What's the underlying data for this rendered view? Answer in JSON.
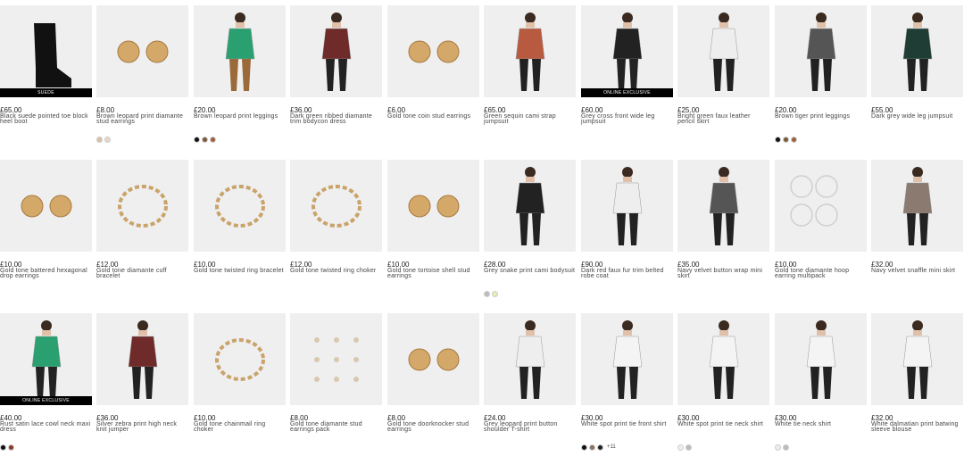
{
  "products": [
    {
      "price": "£65.00",
      "name": "Black suede pointed toe block heel boot",
      "badge": "SUEDE",
      "swatches": [],
      "more": "",
      "image": "black-boot-icon"
    },
    {
      "price": "£8.00",
      "name": "Brown leopard print diamante stud earrings",
      "badge": "",
      "swatches": [
        "#d9c1a5",
        "#e6d7cc"
      ],
      "more": "",
      "image": "stud-earrings-icon"
    },
    {
      "price": "£20.00",
      "name": "Brown leopard print leggings",
      "badge": "",
      "swatches": [
        "#111111",
        "#7a5a3a",
        "#a06040"
      ],
      "more": "",
      "image": "model-leggings-icon"
    },
    {
      "price": "£36.00",
      "name": "Dark green ribbed diamante trim bodycon dress",
      "badge": "",
      "swatches": [],
      "more": "",
      "image": "model-dress-icon"
    },
    {
      "price": "£6.00",
      "name": "Gold tone coin stud earrings",
      "badge": "",
      "swatches": [],
      "more": "",
      "image": "coin-earrings-icon"
    },
    {
      "price": "£65.00",
      "name": "Green sequin cami strap jumpsuit",
      "badge": "",
      "swatches": [],
      "more": "",
      "image": "model-jumpsuit-icon"
    },
    {
      "price": "£60.00",
      "name": "Grey cross front wide leg jumpsuit",
      "badge": "ONLINE EXCLUSIVE",
      "swatches": [],
      "more": "",
      "image": "model-jumpsuit-icon"
    },
    {
      "price": "£25.00",
      "name": "Bright green faux leather pencil skirt",
      "badge": "",
      "swatches": [],
      "more": "",
      "image": "model-skirt-icon"
    },
    {
      "price": "£20.00",
      "name": "Brown tiger print leggings",
      "badge": "",
      "swatches": [
        "#111111",
        "#7a5a3a",
        "#a06040"
      ],
      "more": "",
      "image": "model-crouch-icon"
    },
    {
      "price": "£55.00",
      "name": "Dark grey wide leg jumpsuit",
      "badge": "",
      "swatches": [],
      "more": "",
      "image": "model-jumpsuit-icon"
    },
    {
      "price": "£10.00",
      "name": "Gold tone battered hexagonal drop earrings",
      "badge": "",
      "swatches": [],
      "more": "",
      "image": "drop-earrings-icon"
    },
    {
      "price": "£12.00",
      "name": "Gold tone diamante cuff bracelet",
      "badge": "",
      "swatches": [],
      "more": "",
      "image": "cuff-bracelet-icon"
    },
    {
      "price": "£10.00",
      "name": "Gold tone twisted ring bracelet",
      "badge": "",
      "swatches": [],
      "more": "",
      "image": "ring-bracelet-icon"
    },
    {
      "price": "£12.00",
      "name": "Gold tone twisted ring choker",
      "badge": "",
      "swatches": [],
      "more": "",
      "image": "ring-choker-icon"
    },
    {
      "price": "£10.00",
      "name": "Gold tone tortoise shell stud earrings",
      "badge": "",
      "swatches": [],
      "more": "",
      "image": "tortoise-earrings-icon"
    },
    {
      "price": "£28.00",
      "name": "Grey snake print cami bodysuit",
      "badge": "",
      "swatches": [
        "#bbbbbb",
        "#e8efb0"
      ],
      "more": "",
      "image": "model-bodysuit-icon"
    },
    {
      "price": "£90.00",
      "name": "Dark red faux fur trim belted robe coat",
      "badge": "",
      "swatches": [],
      "more": "",
      "image": "model-coat-icon"
    },
    {
      "price": "£35.00",
      "name": "Navy velvet button wrap mini skirt",
      "badge": "",
      "swatches": [],
      "more": "",
      "image": "model-skirt-icon"
    },
    {
      "price": "£10.00",
      "name": "Gold tone diamante hoop earring multipack",
      "badge": "",
      "swatches": [],
      "more": "",
      "image": "hoop-earrings-icon"
    },
    {
      "price": "£32.00",
      "name": "Navy velvet snaffle mini skirt",
      "badge": "",
      "swatches": [],
      "more": "",
      "image": "model-skirt-icon"
    },
    {
      "price": "£40.00",
      "name": "Rust satin lace cowl neck maxi dress",
      "badge": "ONLINE EXCLUSIVE",
      "swatches": [
        "#111111",
        "#8a3a2a"
      ],
      "more": "",
      "image": "model-dress-icon"
    },
    {
      "price": "£36.00",
      "name": "Silver zebra print high neck knit jumper",
      "badge": "",
      "swatches": [],
      "more": "",
      "image": "model-jumper-icon"
    },
    {
      "price": "£10.00",
      "name": "Gold tone chainmail ring choker",
      "badge": "",
      "swatches": [],
      "more": "",
      "image": "chain-choker-icon"
    },
    {
      "price": "£8.00",
      "name": "Gold tone diamante stud earrings pack",
      "badge": "",
      "swatches": [],
      "more": "",
      "image": "stud-pack-icon"
    },
    {
      "price": "£8.00",
      "name": "Gold tone doorknocker stud earrings",
      "badge": "",
      "swatches": [],
      "more": "",
      "image": "doorknocker-earrings-icon"
    },
    {
      "price": "£24.00",
      "name": "Grey leopard print button shoulder T-shirt",
      "badge": "",
      "swatches": [],
      "more": "",
      "image": "model-top-icon"
    },
    {
      "price": "£30.00",
      "name": "White spot print tie front shirt",
      "badge": "",
      "swatches": [
        "#111111",
        "#8a7060",
        "#222222"
      ],
      "more": "+11",
      "image": "model-shirt-icon"
    },
    {
      "price": "£30.00",
      "name": "White spot print tie neck shirt",
      "badge": "",
      "swatches": [
        "#eeeeee",
        "#bbbbbb"
      ],
      "more": "",
      "image": "model-shirt-icon"
    },
    {
      "price": "£30.00",
      "name": "White tie neck shirt",
      "badge": "",
      "swatches": [
        "#eeeeee",
        "#bbbbbb"
      ],
      "more": "",
      "image": "model-shirt-icon"
    },
    {
      "price": "£32.00",
      "name": "White dalmatian print batwing sleeve blouse",
      "badge": "",
      "swatches": [],
      "more": "",
      "image": "model-blouse-icon"
    }
  ]
}
